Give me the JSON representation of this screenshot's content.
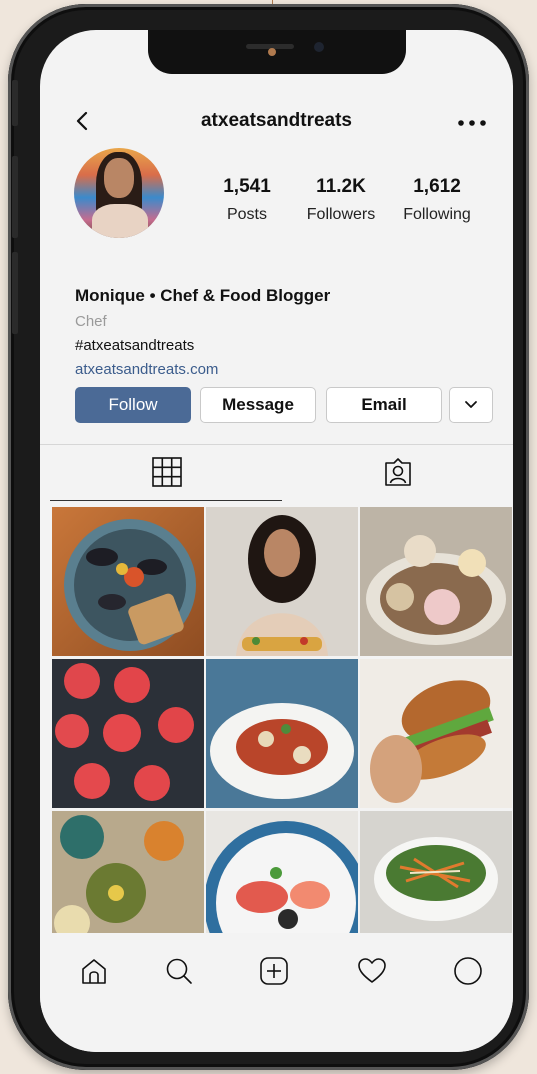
{
  "profile": {
    "username": "atxeatsandtreats",
    "stats": [
      {
        "value": "1,541",
        "label": "Posts"
      },
      {
        "value": "11.2K",
        "label": "Followers"
      },
      {
        "value": "1,612",
        "label": "Following"
      }
    ],
    "bio": {
      "name": "Monique • Chef & Food Blogger",
      "category": "Chef",
      "hashtag": "#atxeatsandtreats",
      "link": "atxeatsandtreats.com"
    },
    "buttons": {
      "follow": "Follow",
      "message": "Message",
      "email": "Email"
    }
  },
  "icons": {
    "back": "chevron-left-icon",
    "more": "more-horizontal-icon",
    "more_options": "chevron-down-icon",
    "tab_grid": "grid-icon",
    "tab_tagged": "tagged-person-icon",
    "nav": [
      "home-icon",
      "search-icon",
      "add-post-icon",
      "heart-icon",
      "profile-circle-icon"
    ]
  },
  "posts": [
    {
      "subject": "mussels and grilled bread dish"
    },
    {
      "subject": "chef smiling holding tacos"
    },
    {
      "subject": "decorated dessert pastries"
    },
    {
      "subject": "red glazed cream puffs"
    },
    {
      "subject": "plated pasta with sauce"
    },
    {
      "subject": "hands holding a sandwich"
    },
    {
      "subject": "mezze spread on patterned tile"
    },
    {
      "subject": "sushi poke bowl"
    },
    {
      "subject": "shredded salad in bowl"
    }
  ],
  "colors": {
    "follow_button": "#4b6a96",
    "link": "#3b5c8c",
    "category": "#9a9a9a",
    "background": "#efe6dc"
  }
}
